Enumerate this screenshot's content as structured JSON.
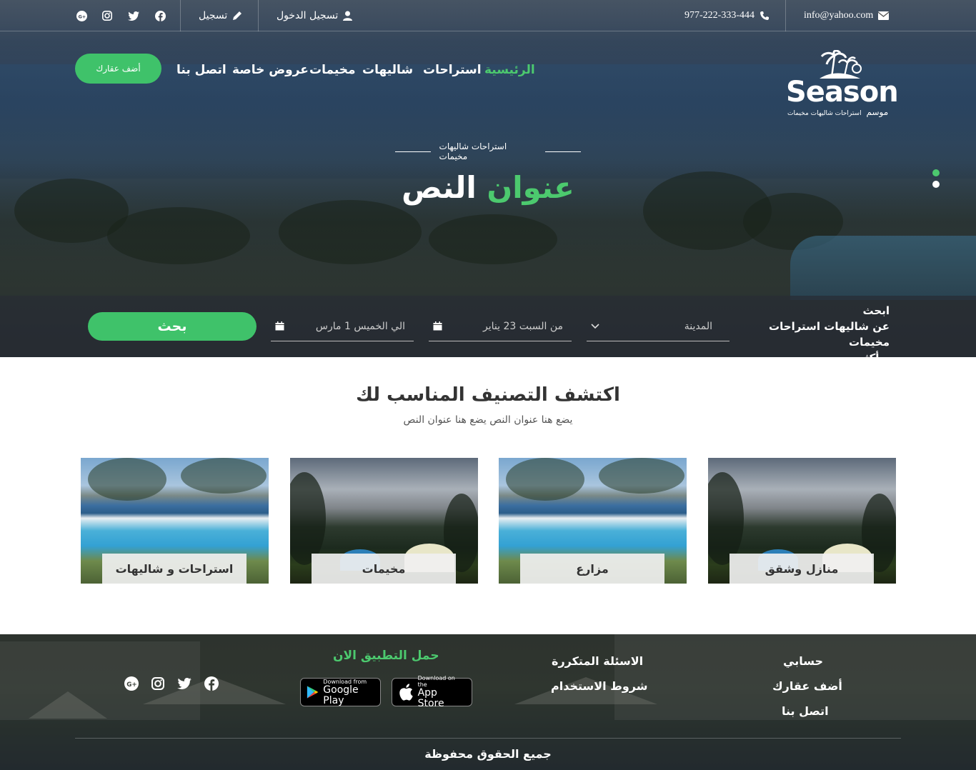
{
  "topbar": {
    "email": "info@yahoo.com",
    "phone": "977-222-333-444",
    "login": "تسجيل الدخول",
    "register": "تسجيل",
    "social_icons": [
      "google-plus-icon",
      "instagram-icon",
      "twitter-icon",
      "facebook-icon"
    ]
  },
  "brand": {
    "name": "Season",
    "arabic_name": "موسم",
    "tagline": "استراحات  شاليهات  مخيمات"
  },
  "nav": {
    "items": [
      "الرئيسية",
      "استراحات",
      "شاليهات",
      "مخيمات",
      "عروض خاصة",
      "اتصل بنا"
    ],
    "active_index": 0,
    "add_property": "أضف عقارك"
  },
  "hero": {
    "subtitle": "استراحات شاليهات مخيمات",
    "title_white": "النص",
    "title_green": "عنوان",
    "slides_count": 2,
    "active_slide": 0
  },
  "search": {
    "label_line1": "ابحث",
    "label_line2": "عن شاليهات استراحات مخيمات",
    "label_line3": "و أكثر",
    "city_placeholder": "المدينة",
    "from_date": "من السبت 23 يناير",
    "to_date": "الي الخميس 1 مارس",
    "button": "بحث"
  },
  "categories": {
    "title": "اكتشف التصنيف المناسب لك",
    "subtitle": "يضع هنا عنوان النص يضع هنا عنوان النص",
    "items": [
      {
        "label": "منازل وشقق"
      },
      {
        "label": "مزارع"
      },
      {
        "label": "مخيمات"
      },
      {
        "label": "استراحات و شاليهات"
      }
    ]
  },
  "footer": {
    "col1": [
      "حسابي",
      "أضف عقارك",
      "اتصل بنا"
    ],
    "col2": [
      "الاسئلة المتكررة",
      "شروط الاستخدام"
    ],
    "app_title": "حمل التطبيق الان",
    "google_play_small": "Download from",
    "google_play_big": "Google Play",
    "app_store_small": "Download on the",
    "app_store_big": "App Store",
    "copyright": "جميع الحقوق محفوظة"
  },
  "colors": {
    "accent": "#3fc26a",
    "accent_text": "#4cc96e",
    "dark_overlay": "#282c34"
  }
}
